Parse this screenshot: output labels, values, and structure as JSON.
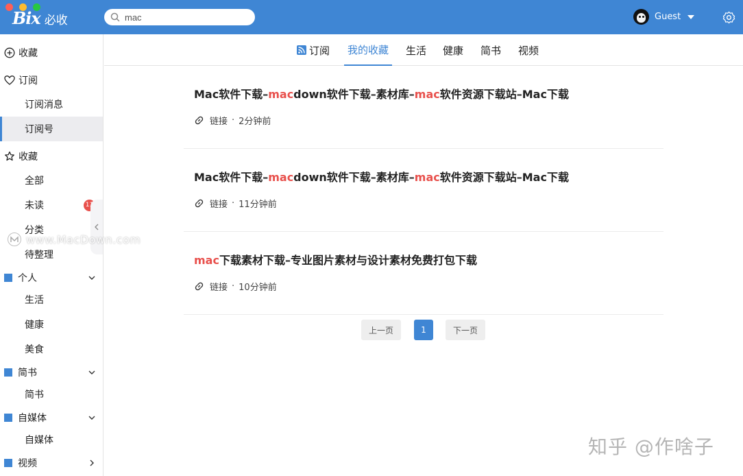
{
  "window": {
    "logo_mark": "Bix",
    "logo_text": "必收"
  },
  "search": {
    "value": "mac",
    "placeholder": ""
  },
  "user": {
    "name": "Guest"
  },
  "sidebar": {
    "collect": "收藏",
    "subscribe": "订阅",
    "subscribe_messages": "订阅消息",
    "subscribe_accounts": "订阅号",
    "favorites": "收藏",
    "all": "全部",
    "unread": "未读",
    "unread_badge": "11",
    "category": "分类",
    "todo": "待整理",
    "groups": [
      {
        "label": "个人",
        "children": [
          "生活",
          "健康",
          "美食"
        ]
      },
      {
        "label": "简书",
        "children": [
          "简书"
        ]
      },
      {
        "label": "自媒体",
        "children": [
          "自媒体"
        ]
      },
      {
        "label": "视频",
        "children": []
      }
    ]
  },
  "watermark": "www.MacDown.com",
  "tabs": [
    "订阅",
    "我的收藏",
    "生活",
    "健康",
    "简书",
    "视频"
  ],
  "items": [
    {
      "title_parts": [
        "Mac软件下载–",
        "mac",
        "down软件下载–素材库–",
        "mac",
        "软件资源下载站–Mac下载"
      ],
      "type": "链接",
      "time": "2分钟前"
    },
    {
      "title_parts": [
        "Mac软件下载–",
        "mac",
        "down软件下载–素材库–",
        "mac",
        "软件资源下载站–Mac下载"
      ],
      "type": "链接",
      "time": "11分钟前"
    },
    {
      "title_parts": [
        "mac",
        "下载素材下载–专业图片素材与设计素材免费打包下载"
      ],
      "type": "链接",
      "time": "10分钟前"
    }
  ],
  "pagination": {
    "prev": "上一页",
    "current": "1",
    "next": "下一页"
  },
  "footer_watermark": "知乎 @作啥子",
  "colors": {
    "accent": "#3f86d4",
    "highlight": "#e8504c"
  }
}
